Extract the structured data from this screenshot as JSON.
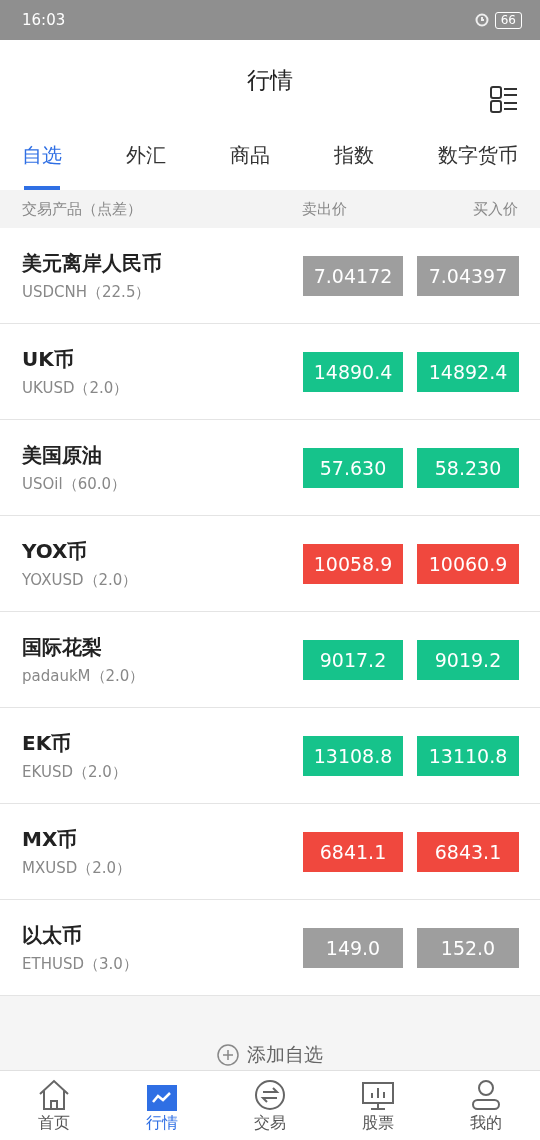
{
  "status_bar": {
    "time": "16:03",
    "battery": "66"
  },
  "header": {
    "title": "行情"
  },
  "tabs": [
    {
      "label": "自选",
      "selected": true
    },
    {
      "label": "外汇",
      "selected": false
    },
    {
      "label": "商品",
      "selected": false
    },
    {
      "label": "指数",
      "selected": false
    },
    {
      "label": "数字货币",
      "selected": false
    }
  ],
  "table": {
    "columns": [
      "交易产品（点差）",
      "卖出价",
      "买入价"
    ],
    "rows": [
      {
        "name": "美元离岸人民币",
        "code": "USDCNH（22.5）",
        "sell": "7.04172",
        "buy": "7.04397",
        "kind": "flat"
      },
      {
        "name": "UK币",
        "code": "UKUSD（2.0）",
        "sell": "14890.4",
        "buy": "14892.4",
        "kind": "up"
      },
      {
        "name": "美国原油",
        "code": "USOil（60.0）",
        "sell": "57.630",
        "buy": "58.230",
        "kind": "up"
      },
      {
        "name": "YOX币",
        "code": "YOXUSD（2.0）",
        "sell": "10058.9",
        "buy": "10060.9",
        "kind": "down"
      },
      {
        "name": "国际花梨",
        "code": "padaukM（2.0）",
        "sell": "9017.2",
        "buy": "9019.2",
        "kind": "up"
      },
      {
        "name": "EK币",
        "code": "EKUSD（2.0）",
        "sell": "13108.8",
        "buy": "13110.8",
        "kind": "up"
      },
      {
        "name": "MX币",
        "code": "MXUSD（2.0）",
        "sell": "6841.1",
        "buy": "6843.1",
        "kind": "down"
      },
      {
        "name": "以太币",
        "code": "ETHUSD（3.0）",
        "sell": "149.0",
        "buy": "152.0",
        "kind": "flat"
      }
    ]
  },
  "add_button": {
    "label": "添加自选"
  },
  "bottom_nav": [
    {
      "label": "首页",
      "kind": "home",
      "selected": false
    },
    {
      "label": "行情",
      "kind": "chart",
      "selected": true
    },
    {
      "label": "交易",
      "kind": "exchange",
      "selected": false
    },
    {
      "label": "股票",
      "kind": "monitor",
      "selected": false
    },
    {
      "label": "我的",
      "kind": "person",
      "selected": false
    }
  ]
}
